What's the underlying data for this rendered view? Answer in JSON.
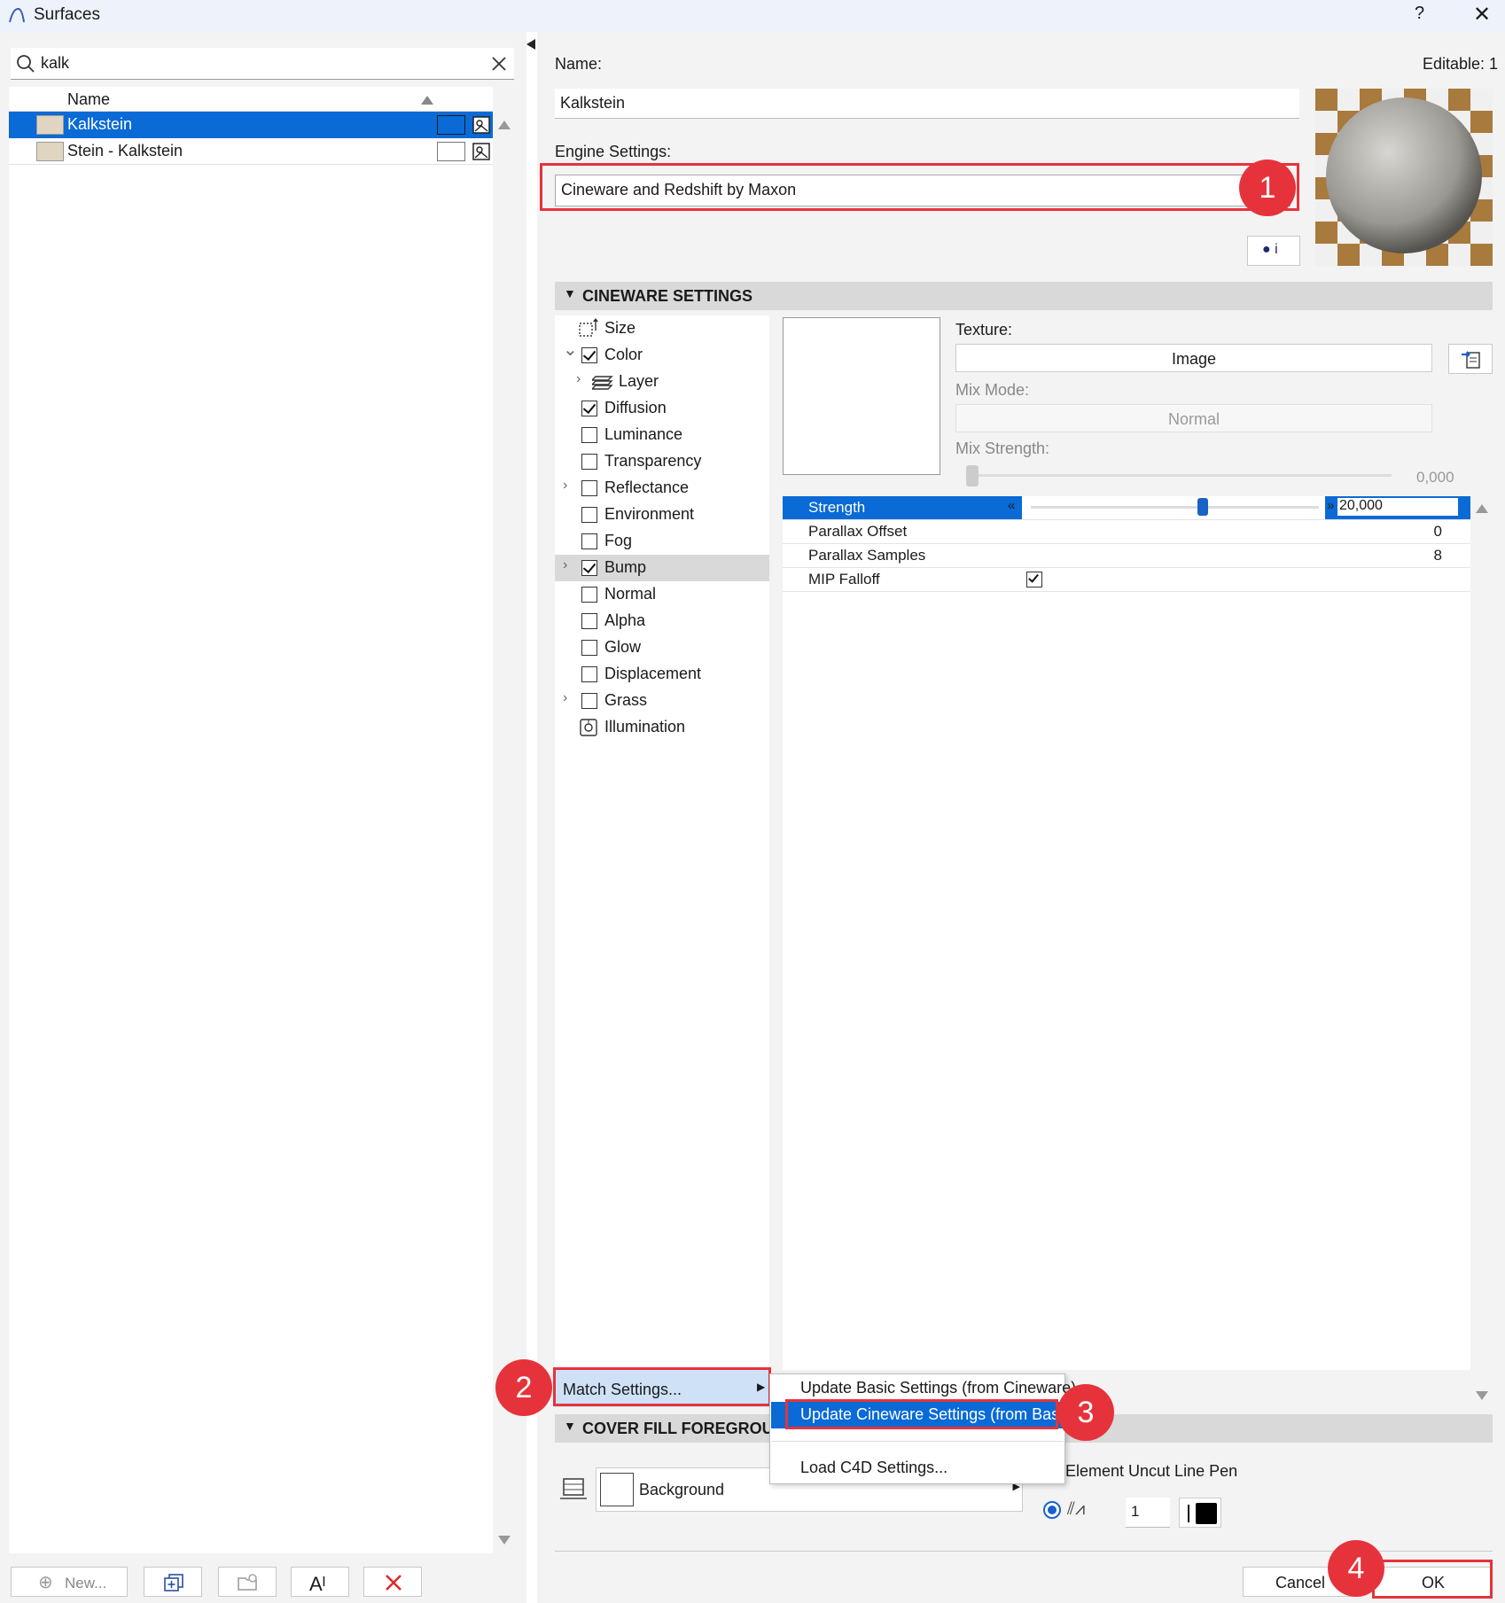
{
  "window": {
    "title": "Surfaces",
    "help": "?",
    "close": "✕"
  },
  "search": {
    "value": "kalk"
  },
  "list": {
    "header": "Name",
    "rows": [
      {
        "label": "Kalkstein",
        "selected": true
      },
      {
        "label": "Stein - Kalkstein",
        "selected": false
      }
    ]
  },
  "bottom_left": {
    "new_label": "New..."
  },
  "details": {
    "name_label": "Name:",
    "editable": "Editable: 1",
    "name_value": "Kalkstein",
    "engine_label": "Engine Settings:",
    "engine_value": "Cineware and Redshift by Maxon"
  },
  "badges": [
    "1",
    "2",
    "3",
    "4"
  ],
  "cineware": {
    "section_title": "CINEWARE SETTINGS",
    "tree": [
      {
        "label": "Size",
        "checkbox": false,
        "icon": "size-icon",
        "chev": "",
        "selected": false
      },
      {
        "label": "Color",
        "checkbox": true,
        "checked": true,
        "chev": "⌄",
        "selected": false
      },
      {
        "label": "Layer",
        "checkbox": false,
        "icon": "layer-icon",
        "chev": "›",
        "indent": true,
        "selected": false
      },
      {
        "label": "Diffusion",
        "checkbox": true,
        "checked": true,
        "chev": "",
        "selected": false
      },
      {
        "label": "Luminance",
        "checkbox": true,
        "checked": false,
        "chev": "",
        "selected": false
      },
      {
        "label": "Transparency",
        "checkbox": true,
        "checked": false,
        "chev": "",
        "selected": false
      },
      {
        "label": "Reflectance",
        "checkbox": true,
        "checked": false,
        "chev": "›",
        "selected": false
      },
      {
        "label": "Environment",
        "checkbox": true,
        "checked": false,
        "chev": "",
        "selected": false
      },
      {
        "label": "Fog",
        "checkbox": true,
        "checked": false,
        "chev": "",
        "selected": false
      },
      {
        "label": "Bump",
        "checkbox": true,
        "checked": true,
        "chev": "›",
        "selected": true
      },
      {
        "label": "Normal",
        "checkbox": true,
        "checked": false,
        "chev": "",
        "selected": false
      },
      {
        "label": "Alpha",
        "checkbox": true,
        "checked": false,
        "chev": "",
        "selected": false
      },
      {
        "label": "Glow",
        "checkbox": true,
        "checked": false,
        "chev": "",
        "selected": false
      },
      {
        "label": "Displacement",
        "checkbox": true,
        "checked": false,
        "chev": "",
        "selected": false
      },
      {
        "label": "Grass",
        "checkbox": true,
        "checked": false,
        "chev": "›",
        "selected": false
      },
      {
        "label": "Illumination",
        "checkbox": false,
        "icon": "illumination-icon",
        "chev": "",
        "selected": false
      }
    ],
    "texture_label": "Texture:",
    "texture_value": "Image",
    "mix_mode_label": "Mix Mode:",
    "mix_mode_value": "Normal",
    "mix_strength_label": "Mix Strength:",
    "mix_strength_value": "0,000",
    "properties": [
      {
        "label": "Strength",
        "value": "20,000",
        "selected": true
      },
      {
        "label": "Parallax Offset",
        "value": "0"
      },
      {
        "label": "Parallax Samples",
        "value": "8"
      },
      {
        "label": "MIP Falloff",
        "value": "",
        "checkbox": true
      }
    ]
  },
  "match_settings": {
    "label": "Match Settings...",
    "menu": [
      {
        "label": "Update Basic Settings (from Cineware)"
      },
      {
        "label": "Update Cineware Settings (from Basic)",
        "highlighted": true
      },
      {
        "label": "Load C4D Settings..."
      }
    ]
  },
  "cover_fill": {
    "section_title": "COVER FILL FOREGROUND",
    "fill_value": "Background",
    "pen_label": "Element Uncut Line Pen",
    "pen_value": "1"
  },
  "buttons": {
    "cancel": "Cancel",
    "ok": "OK"
  }
}
